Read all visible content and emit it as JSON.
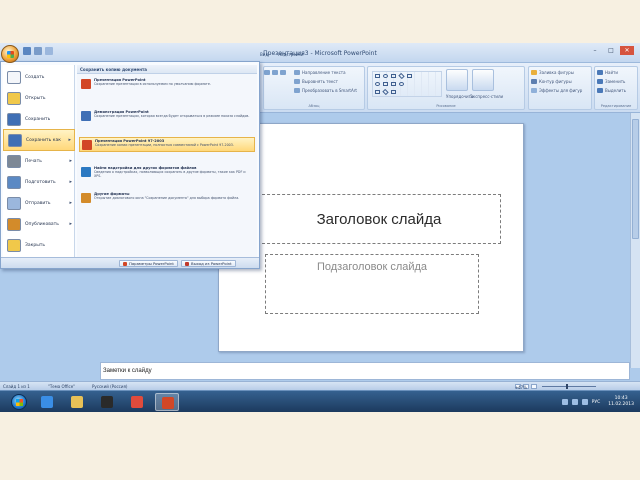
{
  "window": {
    "title": "Презентация3 - Microsoft PowerPoint",
    "controls": [
      "–",
      "□",
      "✕"
    ]
  },
  "ribbon": {
    "tabs": [
      "Вид",
      "Надстройки"
    ],
    "groups": {
      "paragraph_rows": [
        "Направление текста",
        "Выровнять текст",
        "Преобразовать в SmartArt"
      ],
      "arrange_label": "Упорядочить",
      "quick_styles_label": "Экспресс-стили",
      "style_rows": [
        "Заливка фигуры",
        "Контур фигуры",
        "Эффекты для фигур"
      ],
      "editing_rows": [
        "Найти",
        "Заменить",
        "Выделить"
      ],
      "labels": [
        "Абзац",
        "Рисование",
        "Редактирование"
      ]
    }
  },
  "office_menu": {
    "items": [
      {
        "label": "Создать",
        "icon_color": "#f4f6fa",
        "has_arrow": false
      },
      {
        "label": "Открыть",
        "icon_color": "#f0c84a",
        "has_arrow": false
      },
      {
        "label": "Сохранить",
        "icon_color": "#3f6fb5",
        "has_arrow": false
      },
      {
        "label": "Сохранить как",
        "icon_color": "#3f6fb5",
        "has_arrow": true,
        "selected": true
      },
      {
        "label": "Печать",
        "icon_color": "#7d8896",
        "has_arrow": true
      },
      {
        "label": "Подготовить",
        "icon_color": "#5b89c4",
        "has_arrow": true
      },
      {
        "label": "Отправить",
        "icon_color": "#9bb7dd",
        "has_arrow": true
      },
      {
        "label": "Опубликовать",
        "icon_color": "#d38b2a",
        "has_arrow": true
      },
      {
        "label": "Закрыть",
        "icon_color": "#f0c84a",
        "has_arrow": false
      }
    ],
    "submenu_header": "Сохранить копию документа",
    "submenu": [
      {
        "title": "Презентация PowerPoint",
        "desc": "Сохранение презентации в используемом по умолчанию формате.",
        "icon_color": "#d24726"
      },
      {
        "title": "Демонстрация PowerPoint",
        "desc": "Сохранение презентации, которая всегда будет открываться в режиме показа слайдов.",
        "icon_color": "#3f6fb5"
      },
      {
        "title": "Презентация PowerPoint 97-2003",
        "desc": "Сохранение копии презентации, полностью совместимой с PowerPoint 97-2003.",
        "icon_color": "#d24726",
        "selected": true
      },
      {
        "title": "Найти надстройки для других форматов файлов",
        "desc": "Сведения о надстройках, позволяющих сохранять в другие форматы, такие как PDF и XPS.",
        "icon_color": "#2b79c2"
      },
      {
        "title": "Другие форматы",
        "desc": "Открытие диалогового окна \"Сохранение документа\" для выбора формата файла.",
        "icon_color": "#d38b2a"
      }
    ],
    "bottom_buttons": [
      "Параметры PowerPoint",
      "Выход из PowerPoint"
    ]
  },
  "slide": {
    "title_placeholder": "Заголовок слайда",
    "subtitle_placeholder": "Подзаголовок слайда"
  },
  "notes": {
    "placeholder": "Заметки к слайду"
  },
  "status_bar": {
    "slide_info": "Слайд 1 из 1",
    "theme": "\"Тема Office\"",
    "language": "Русский (Россия)",
    "zoom_percent": "47%",
    "zoom_level": 0.47
  },
  "taskbar": {
    "apps": [
      {
        "name": "ie",
        "color": "#3a8ee6"
      },
      {
        "name": "explorer",
        "color": "#e8c157"
      },
      {
        "name": "media",
        "color": "#2a2a2a"
      },
      {
        "name": "chrome",
        "color": "#e04b3c"
      },
      {
        "name": "powerpoint",
        "color": "#d24726",
        "active": true
      }
    ],
    "language": "РУС",
    "time": "10:43",
    "date": "11.02.2013"
  }
}
